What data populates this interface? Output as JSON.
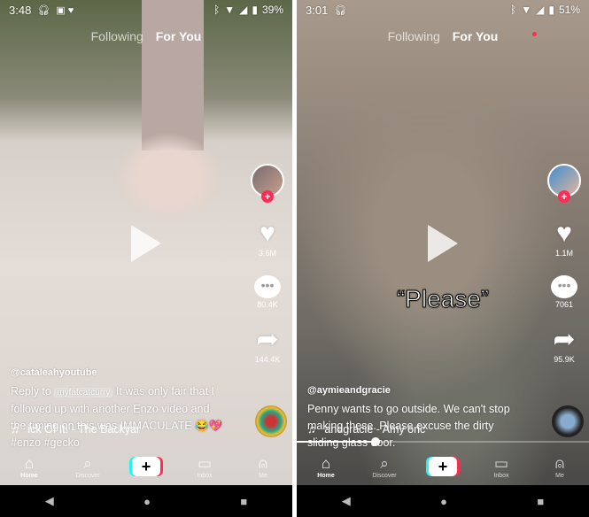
{
  "phones": [
    {
      "status": {
        "time": "3:48",
        "icons": [
          "headphones-icon",
          "w-app-icon",
          "heart-icon"
        ],
        "battery": "39%"
      },
      "tabs": {
        "following": "Following",
        "for_you": "For You",
        "following_dot": false
      },
      "overlay_text": "",
      "likes": "3.6M",
      "comments": "80.4K",
      "shares": "144.4K",
      "username": "@cataleahyoutube",
      "reply_prefix": "Reply to",
      "mention": "myfatcatcurry",
      "caption": "It was only fair that I followed up with another Enzo video and the timing on this was IMMACULATE 😂💖 #enzo #gecko",
      "music": "ick Of It! - The Backyar",
      "progress": null
    },
    {
      "status": {
        "time": "3:01",
        "icons": [
          "headphones-icon"
        ],
        "battery": "51%"
      },
      "tabs": {
        "following": "Following",
        "for_you": "For You",
        "following_dot": true
      },
      "overlay_text": "“Please”",
      "likes": "1.1M",
      "comments": "7061",
      "shares": "95.9K",
      "username": "@aymieandgracie",
      "reply_prefix": "",
      "mention": "",
      "caption": "Penny wants to go outside. We can't stop making these. Please excuse the dirty sliding glass door.",
      "music": "andgracie - Amy   oric",
      "progress": 0.27
    }
  ],
  "nav": {
    "home": "Home",
    "discover": "Discover",
    "create": "+",
    "inbox": "Inbox",
    "me": "Me"
  },
  "sysnav": {
    "back": "◀",
    "home": "●",
    "recents": "■"
  },
  "colors": {
    "accent": "#fe2c55",
    "cyan": "#25f4ee"
  }
}
